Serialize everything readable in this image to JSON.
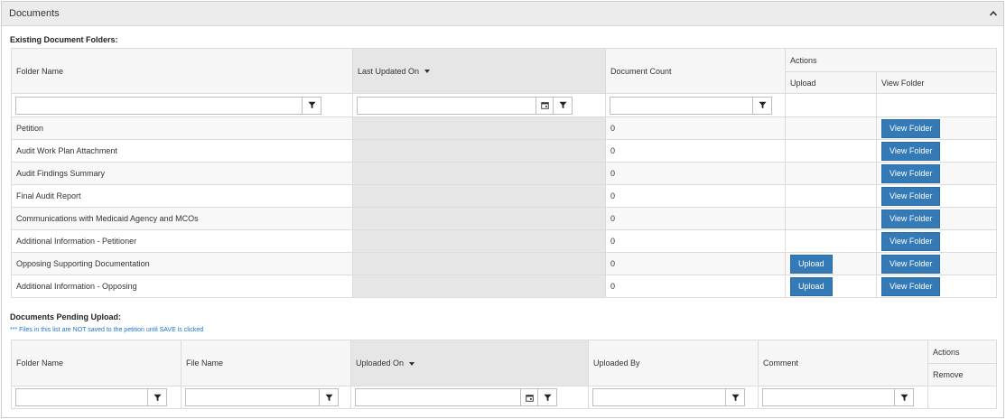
{
  "panel": {
    "title": "Documents"
  },
  "existing": {
    "title": "Existing Document Folders:",
    "headers": {
      "folder_name": "Folder Name",
      "last_updated": "Last Updated On",
      "doc_count": "Document Count",
      "actions": "Actions",
      "upload": "Upload",
      "view_folder": "View Folder"
    },
    "filters": {
      "folder_name": "",
      "last_updated": "",
      "doc_count": ""
    },
    "rows": [
      {
        "name": "Petition",
        "updated": "",
        "count": "0",
        "upload": "",
        "view": "View Folder"
      },
      {
        "name": "Audit Work Plan Attachment",
        "updated": "",
        "count": "0",
        "upload": "",
        "view": "View Folder"
      },
      {
        "name": "Audit Findings Summary",
        "updated": "",
        "count": "0",
        "upload": "",
        "view": "View Folder"
      },
      {
        "name": "Final Audit Report",
        "updated": "",
        "count": "0",
        "upload": "",
        "view": "View Folder"
      },
      {
        "name": "Communications with Medicaid Agency and MCOs",
        "updated": "",
        "count": "0",
        "upload": "",
        "view": "View Folder"
      },
      {
        "name": "Additional Information - Petitioner",
        "updated": "",
        "count": "0",
        "upload": "",
        "view": "View Folder"
      },
      {
        "name": "Opposing Supporting Documentation",
        "updated": "",
        "count": "0",
        "upload": "Upload",
        "view": "View Folder"
      },
      {
        "name": "Additional Information - Opposing",
        "updated": "",
        "count": "0",
        "upload": "Upload",
        "view": "View Folder"
      }
    ]
  },
  "pending": {
    "title": "Documents Pending Upload:",
    "note": "*** Files in this list are NOT saved to the petition until SAVE is clicked",
    "headers": {
      "folder_name": "Folder Name",
      "file_name": "File Name",
      "uploaded_on": "Uploaded On",
      "uploaded_by": "Uploaded By",
      "comment": "Comment",
      "actions": "Actions",
      "remove": "Remove"
    },
    "filters": {
      "folder_name": "",
      "file_name": "",
      "uploaded_on": "",
      "uploaded_by": "",
      "comment": ""
    }
  },
  "icons": {
    "filter": "filter-icon",
    "calendar": "calendar-icon",
    "sort": "sort-descending-icon",
    "collapse": "chevron-up-icon"
  },
  "colors": {
    "primary_button": "#337ab7",
    "note_text": "#1a73d9",
    "sorted_column": "#e6e6e6"
  }
}
